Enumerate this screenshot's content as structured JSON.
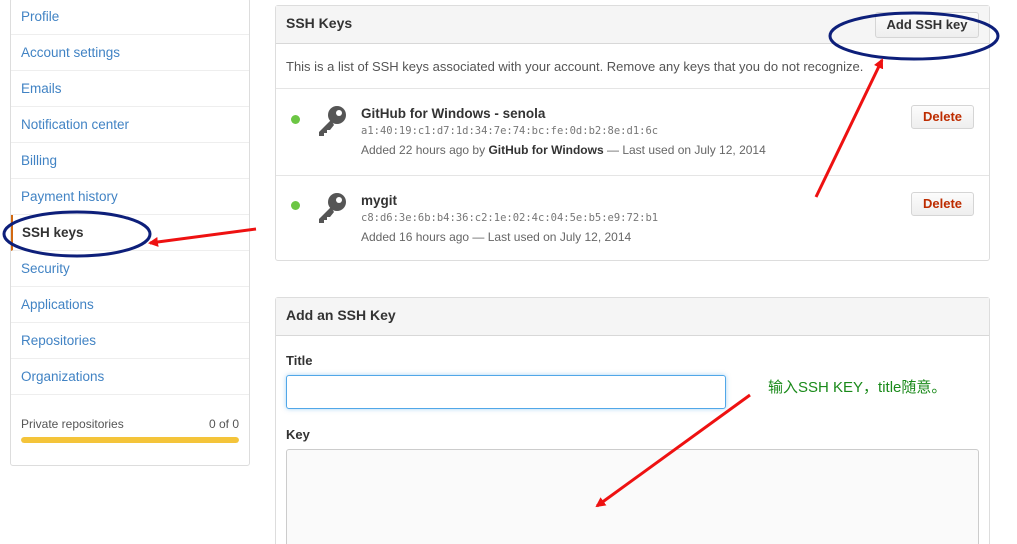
{
  "sidebar": {
    "items": [
      {
        "label": "Profile"
      },
      {
        "label": "Account settings"
      },
      {
        "label": "Emails"
      },
      {
        "label": "Notification center"
      },
      {
        "label": "Billing"
      },
      {
        "label": "Payment history"
      },
      {
        "label": "SSH keys",
        "selected": true
      },
      {
        "label": "Security"
      },
      {
        "label": "Applications"
      },
      {
        "label": "Repositories"
      },
      {
        "label": "Organizations"
      }
    ],
    "private_repos": {
      "label": "Private repositories",
      "value": "0 of 0",
      "fill_fraction": 1.0
    }
  },
  "ssh_keys": {
    "header": "SSH Keys",
    "add_button": "Add SSH key",
    "intro": "This is a list of SSH keys associated with your account. Remove any keys that you do not recognize.",
    "keys": [
      {
        "title": "GitHub for Windows - senola",
        "fingerprint": "a1:40:19:c1:d7:1d:34:7e:74:bc:fe:0d:b2:8e:d1:6c",
        "added_prefix": "Added 22 hours ago by ",
        "added_by": "GitHub for Windows",
        "last_used": " — Last used on July 12, 2014",
        "delete_label": "Delete",
        "status_color": "#6cc644"
      },
      {
        "title": "mygit",
        "fingerprint": "c8:d6:3e:6b:b4:36:c2:1e:02:4c:04:5e:b5:e9:72:b1",
        "added_prefix": "Added 16 hours ago",
        "added_by": "",
        "last_used": " — Last used on July 12, 2014",
        "delete_label": "Delete",
        "status_color": "#6cc644"
      }
    ]
  },
  "add_key": {
    "header": "Add an SSH Key",
    "title_label": "Title",
    "title_value": "",
    "key_label": "Key",
    "key_value": ""
  },
  "annotation": {
    "note": "输入SSH KEY，title随意。",
    "note_color": "#1a8a1a",
    "arrow_color": "#ee1111",
    "ellipse_color": "#0d1f7a"
  },
  "icons": {
    "key": "key-icon",
    "status": "status-dot-icon"
  },
  "colors": {
    "link": "#4183c4",
    "danger": "#bd2c00",
    "accent": "#d26911"
  }
}
